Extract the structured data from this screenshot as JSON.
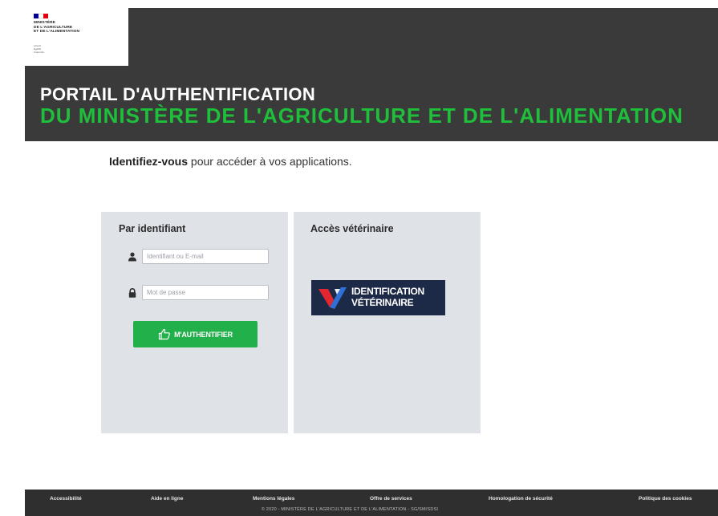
{
  "header": {
    "logo": {
      "flag_colors": [
        "#000091",
        "#ffffff",
        "#e1000f"
      ],
      "lines": "MINISTÈRE\nDE L'AGRICULTURE\nET DE L'ALIMENTATION",
      "motto": "Liberté\nÉgalité\nFraternité"
    },
    "title_line1": "PORTAIL D'AUTHENTIFICATION",
    "title_line2": "DU MINISTÈRE DE L'AGRICULTURE ET DE L'ALIMENTATION",
    "colors": {
      "background": "#3a3a3a",
      "title_white": "#ffffff",
      "title_green": "#1fbf3c"
    }
  },
  "intro": {
    "bold": "Identifiez-vous",
    "rest": " pour accéder à vos applications."
  },
  "login_panel": {
    "title": "Par identifiant",
    "username_placeholder": "Identifiant ou E-mail",
    "username_icon": "user-icon",
    "password_placeholder": "Mot de passe",
    "password_icon": "lock-icon",
    "submit_label": "M'AUTHENTIFIER",
    "submit_icon": "thumbs-up-icon",
    "colors": {
      "panel_bg": "#dfe2e7",
      "button": "#22b04a"
    }
  },
  "vet_panel": {
    "title": "Accès vétérinaire",
    "logo_text": "IDENTIFICATION\nVÉTÉRINAIRE",
    "colors": {
      "logo_bg": "#1d2a47",
      "mark_red": "#e3262f",
      "mark_blue": "#2f6fd6"
    }
  },
  "footer": {
    "links": [
      "Accessibilité",
      "Aide en ligne",
      "Mentions légales",
      "Offre de services",
      "Homologation de sécurité",
      "Politique des cookies"
    ],
    "copyright": "© 2020 - MINISTÈRE DE L'AGRICULTURE ET DE L'ALIMENTATION - SG/SM/SDSI"
  }
}
